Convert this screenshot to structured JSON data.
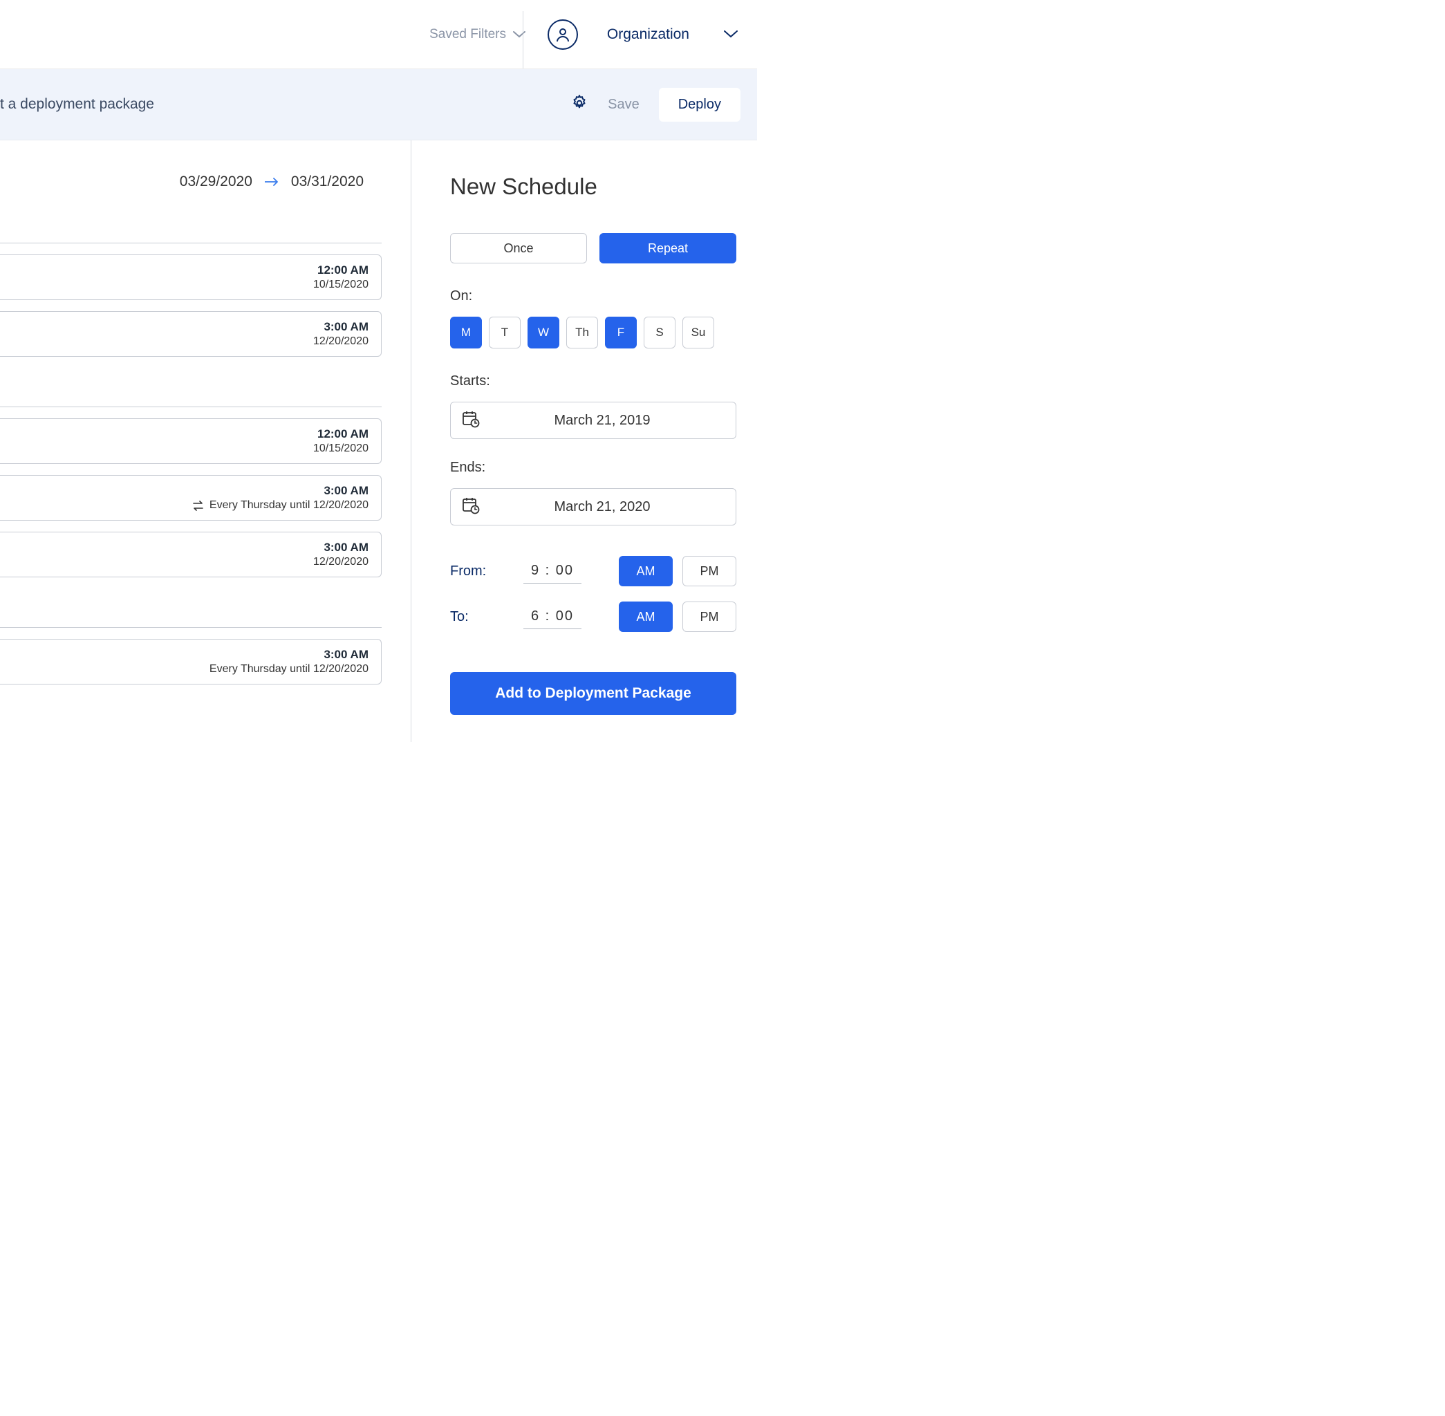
{
  "topbar": {
    "saved_filters": "Saved Filters",
    "organization": "Organization"
  },
  "actionbar": {
    "title_fragment": "t a deployment package",
    "save": "Save",
    "deploy": "Deploy"
  },
  "date_range": {
    "from": "03/29/2020",
    "to": "03/31/2020"
  },
  "schedule_items": [
    {
      "time": "12:00 AM",
      "sub": "10/15/2020"
    },
    {
      "time": "3:00 AM",
      "sub": "12/20/2020"
    },
    {
      "time": "12:00 AM",
      "sub": "10/15/2020"
    },
    {
      "time": "3:00 AM",
      "sub": "Every Thursday until 12/20/2020",
      "repeat": true
    },
    {
      "time": "3:00 AM",
      "sub": "12/20/2020"
    },
    {
      "time": "3:00 AM",
      "sub": "Every Thursday until 12/20/2020",
      "repeat": true
    }
  ],
  "panel": {
    "title": "New Schedule",
    "once": "Once",
    "repeat": "Repeat",
    "on_label": "On:",
    "days": [
      {
        "label": "M",
        "selected": true
      },
      {
        "label": "T",
        "selected": false
      },
      {
        "label": "W",
        "selected": true
      },
      {
        "label": "Th",
        "selected": false
      },
      {
        "label": "F",
        "selected": true
      },
      {
        "label": "S",
        "selected": false
      },
      {
        "label": "Su",
        "selected": false
      }
    ],
    "starts_label": "Starts:",
    "starts_value": "March 21, 2019",
    "ends_label": "Ends:",
    "ends_value": "March 21, 2020",
    "from_label": "From:",
    "from_time": "9 : 00",
    "to_label": "To:",
    "to_time": "6 : 00",
    "am": "AM",
    "pm": "PM",
    "add_button": "Add to Deployment Package"
  }
}
